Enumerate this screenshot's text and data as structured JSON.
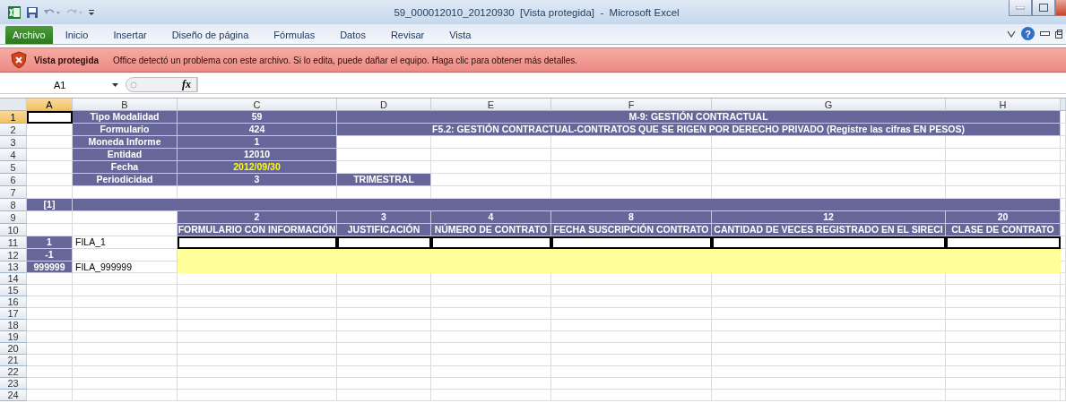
{
  "window": {
    "title": "59_000012010_20120930  [Vista protegida]  -  Microsoft Excel"
  },
  "ribbon": {
    "tabs": [
      {
        "label": "Archivo",
        "selected": true
      },
      {
        "label": "Inicio",
        "selected": false
      },
      {
        "label": "Insertar",
        "selected": false
      },
      {
        "label": "Diseño de página",
        "selected": false
      },
      {
        "label": "Fórmulas",
        "selected": false
      },
      {
        "label": "Datos",
        "selected": false
      },
      {
        "label": "Revisar",
        "selected": false
      },
      {
        "label": "Vista",
        "selected": false
      }
    ],
    "help": "?"
  },
  "message_bar": {
    "title": "Vista protegida",
    "text": "Office detectó un problema con este archivo. Si lo edita, puede dañar el equipo. Haga clic para obtener más detalles."
  },
  "formula_bar": {
    "name_box": "A1",
    "function_label": "fx"
  },
  "columns": [
    {
      "label": "A",
      "selected": true
    },
    {
      "label": "B",
      "selected": false
    },
    {
      "label": "C",
      "selected": false
    },
    {
      "label": "D",
      "selected": false
    },
    {
      "label": "E",
      "selected": false
    },
    {
      "label": "F",
      "selected": false
    },
    {
      "label": "G",
      "selected": false
    },
    {
      "label": "H",
      "selected": false
    }
  ],
  "rows": [
    {
      "label": "1",
      "selected": true,
      "cells": [
        {
          "kind": "active"
        },
        {
          "kind": "header",
          "text": "Tipo Modalidad"
        },
        {
          "kind": "header",
          "text": "59"
        },
        {
          "kind": "header",
          "text": "M-9: GESTIÓN CONTRACTUAL"
        },
        {
          "kind": "merged"
        },
        {
          "kind": "merged"
        },
        {
          "kind": "merged"
        },
        {
          "kind": "merged"
        }
      ]
    },
    {
      "label": "2",
      "selected": false,
      "cells": [
        {
          "kind": "blank"
        },
        {
          "kind": "header",
          "text": "Formulario"
        },
        {
          "kind": "header",
          "text": "424"
        },
        {
          "kind": "header",
          "text": "F5.2: GESTIÓN CONTRACTUAL-CONTRATOS QUE SE RIGEN POR DERECHO PRIVADO (Registre las cifras EN PESOS)"
        },
        {
          "kind": "merged"
        },
        {
          "kind": "merged"
        },
        {
          "kind": "merged"
        },
        {
          "kind": "merged"
        }
      ]
    },
    {
      "label": "3",
      "selected": false,
      "cells": [
        {
          "kind": "blank"
        },
        {
          "kind": "header",
          "text": "Moneda Informe"
        },
        {
          "kind": "header",
          "text": "1"
        }
      ]
    },
    {
      "label": "4",
      "selected": false,
      "cells": [
        {
          "kind": "blank"
        },
        {
          "kind": "header",
          "text": "Entidad"
        },
        {
          "kind": "header",
          "text": "12010"
        }
      ]
    },
    {
      "label": "5",
      "selected": false,
      "cells": [
        {
          "kind": "blank"
        },
        {
          "kind": "header",
          "text": "Fecha"
        },
        {
          "kind": "date",
          "text": "2012/09/30"
        }
      ]
    },
    {
      "label": "6",
      "selected": false,
      "cells": [
        {
          "kind": "blank"
        },
        {
          "kind": "header",
          "text": "Periodicidad"
        },
        {
          "kind": "header",
          "text": "3"
        },
        {
          "kind": "header",
          "text": "TRIMESTRAL"
        }
      ]
    },
    {
      "label": "7",
      "selected": false
    },
    {
      "label": "8",
      "selected": false,
      "cells": [
        {
          "kind": "header",
          "text": "[1]"
        },
        {
          "kind": "header"
        },
        {
          "kind": "merged"
        },
        {
          "kind": "merged"
        },
        {
          "kind": "merged"
        },
        {
          "kind": "merged"
        },
        {
          "kind": "merged"
        },
        {
          "kind": "merged"
        }
      ]
    },
    {
      "label": "9",
      "selected": false,
      "cells": [
        {
          "kind": "blank"
        },
        {
          "kind": "blank"
        },
        {
          "kind": "header",
          "text": "2"
        },
        {
          "kind": "header",
          "text": "3"
        },
        {
          "kind": "header",
          "text": "4"
        },
        {
          "kind": "header",
          "text": "8"
        },
        {
          "kind": "header",
          "text": "12"
        },
        {
          "kind": "header",
          "text": "20"
        }
      ]
    },
    {
      "label": "10",
      "selected": false,
      "cells": [
        {
          "kind": "blank"
        },
        {
          "kind": "blank"
        },
        {
          "kind": "header",
          "text": "FORMULARIO CON INFORMACIÓN"
        },
        {
          "kind": "header",
          "text": "JUSTIFICACIÓN"
        },
        {
          "kind": "header",
          "text": "NÚMERO DE CONTRATO"
        },
        {
          "kind": "header",
          "text": "FECHA SUSCRIPCIÓN CONTRATO"
        },
        {
          "kind": "header",
          "text": "CANTIDAD DE VECES REGISTRADO EN EL SIRECI"
        },
        {
          "kind": "header",
          "text": "CLASE DE CONTRATO"
        }
      ]
    },
    {
      "label": "11",
      "selected": false,
      "cells": [
        {
          "kind": "header",
          "text": "1"
        },
        {
          "kind": "plain",
          "text": "FILA_1"
        },
        {
          "kind": "input"
        },
        {
          "kind": "input"
        },
        {
          "kind": "input"
        },
        {
          "kind": "input"
        },
        {
          "kind": "input"
        },
        {
          "kind": "input"
        }
      ]
    },
    {
      "label": "12",
      "selected": false,
      "cells": [
        {
          "kind": "header",
          "text": "-1"
        },
        {
          "kind": "blank"
        },
        {
          "kind": "highlight"
        },
        {
          "kind": "merged"
        },
        {
          "kind": "merged"
        },
        {
          "kind": "merged"
        },
        {
          "kind": "merged"
        },
        {
          "kind": "merged"
        }
      ]
    },
    {
      "label": "13",
      "selected": false,
      "cells": [
        {
          "kind": "header",
          "text": "999999"
        },
        {
          "kind": "plain",
          "text": "FILA_999999"
        },
        {
          "kind": "highlight"
        },
        {
          "kind": "merged"
        },
        {
          "kind": "merged"
        },
        {
          "kind": "merged"
        },
        {
          "kind": "merged"
        },
        {
          "kind": "merged"
        }
      ]
    },
    {
      "label": "14",
      "selected": false
    },
    {
      "label": "15",
      "selected": false
    },
    {
      "label": "16",
      "selected": false
    },
    {
      "label": "17",
      "selected": false
    },
    {
      "label": "18",
      "selected": false
    },
    {
      "label": "19",
      "selected": false
    },
    {
      "label": "20",
      "selected": false
    },
    {
      "label": "21",
      "selected": false
    },
    {
      "label": "22",
      "selected": false
    },
    {
      "label": "23",
      "selected": false
    },
    {
      "label": "24",
      "selected": false
    }
  ]
}
